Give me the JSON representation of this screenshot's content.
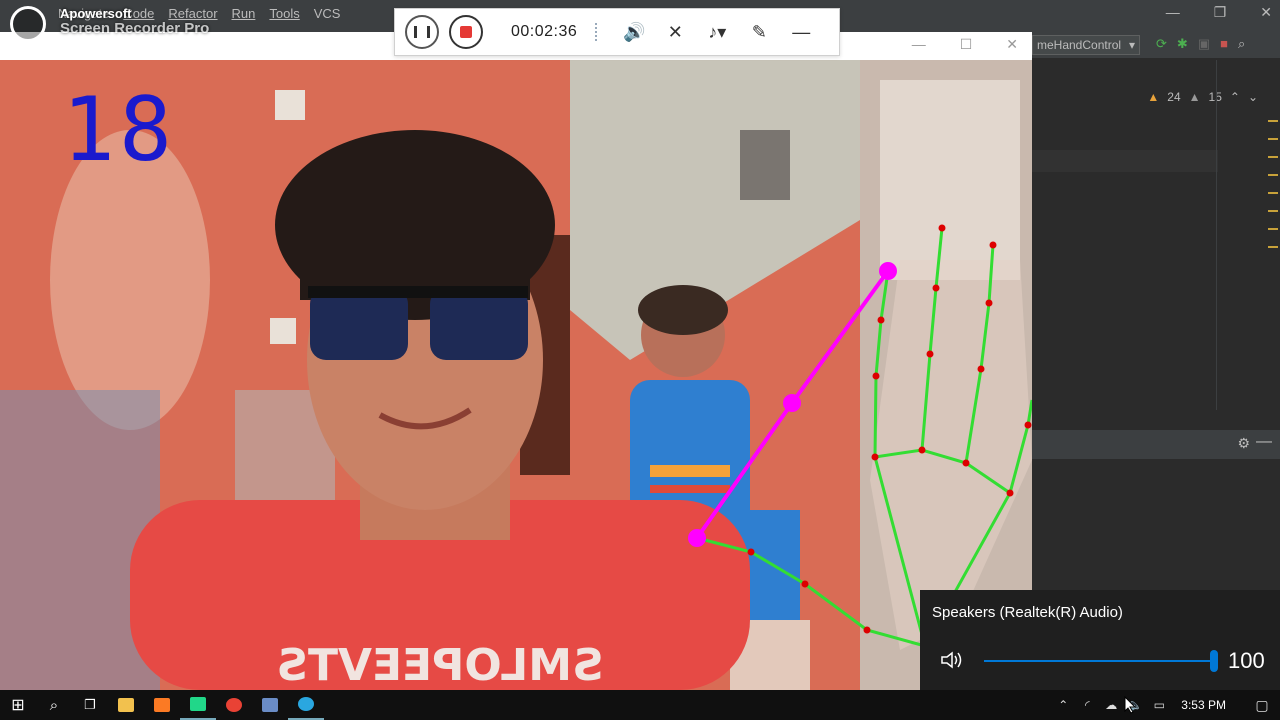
{
  "ide": {
    "menu": [
      "Navigate",
      "Code",
      "Refactor",
      "Run",
      "Tools",
      "VCS"
    ],
    "run_config": "meHandControl",
    "inspections": {
      "warnings": "24",
      "weak_warnings": "15"
    },
    "colors": {
      "bg": "#2b2b2b",
      "panel": "#3c3f41",
      "warning": "#e8a33b"
    }
  },
  "recorder": {
    "brand": "Apowersoft",
    "product": "Screen Recorder Pro",
    "timer": "00:02:36",
    "controls": [
      "pause-icon",
      "stop-icon",
      "speaker-icon",
      "mic-off-icon",
      "system-audio-icon",
      "pen-icon",
      "minimize-icon"
    ]
  },
  "camera": {
    "finger_count": "18",
    "count_color": "#1a1acd",
    "landmark_color": "#ff00ff",
    "skeleton_color": "#33dd33",
    "joint_color": "#dd0000"
  },
  "volume": {
    "device": "Speakers (Realtek(R) Audio)",
    "value": "100",
    "level": 1.0,
    "accent": "#0078d7"
  },
  "taskbar": {
    "apps": [
      "windows-start-icon",
      "search-icon",
      "task-view-icon",
      "file-explorer-icon",
      "xampp-icon",
      "pycharm-icon",
      "chrome-icon",
      "taskbar-app-icon",
      "screen-recorder-icon"
    ],
    "clock": "3:53 PM",
    "tray_icons": [
      "chevron-up-icon",
      "wifi-icon",
      "onedrive-icon",
      "volume-icon",
      "battery-icon"
    ]
  }
}
